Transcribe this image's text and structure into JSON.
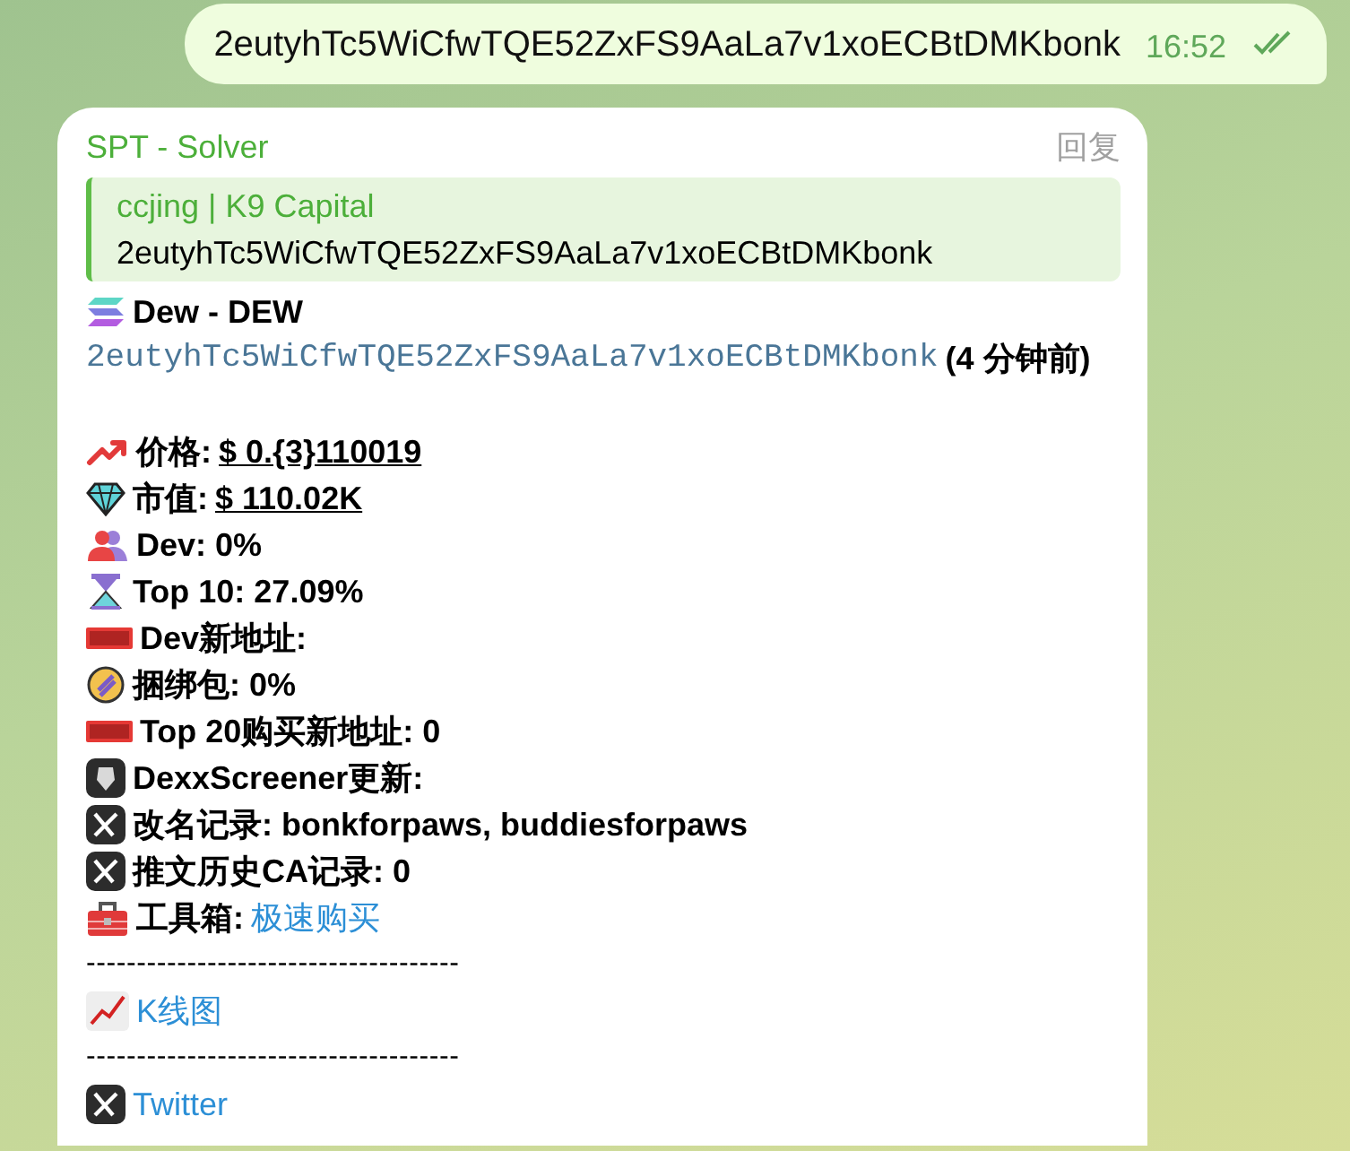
{
  "outgoing": {
    "text": "2eutyhTc5WiCfwTQE52ZxFS9AaLa7v1xoECBtDMKbonk",
    "time": "16:52",
    "read": true
  },
  "incoming": {
    "sender": "SPT - Solver",
    "reply_label": "回复",
    "quote": {
      "author": "ccjing | K9 Capital",
      "text": "2eutyhTc5WiCfwTQE52ZxFS9AaLa7v1xoECBtDMKbonk"
    },
    "token": "Dew - DEW",
    "address": "2eutyhTc5WiCfwTQE52ZxFS9AaLa7v1xoECBtDMKbonk",
    "age": "(4 分钟前)",
    "items": [
      {
        "kind": "metric",
        "label": "价格:",
        "value": "$ 0.{3}110019"
      },
      {
        "kind": "metric",
        "label": "市值:",
        "value": "$ 110.02K"
      },
      {
        "kind": "stat",
        "label": "Dev: 0%"
      },
      {
        "kind": "stat",
        "label": "Top 10: 27.09%"
      },
      {
        "kind": "stat",
        "label": "Dev新地址:"
      },
      {
        "kind": "stat",
        "label": "捆绑包: 0%"
      },
      {
        "kind": "stat",
        "label": "Top 20购买新地址: 0"
      },
      {
        "kind": "stat",
        "label": "DexxScreener更新:"
      },
      {
        "kind": "stat",
        "label": "改名记录: bonkforpaws, buddiesforpaws"
      },
      {
        "kind": "stat",
        "label": "推文历史CA记录: 0"
      },
      {
        "kind": "tool",
        "label": "工具箱:",
        "value": "极速购买"
      },
      {
        "kind": "divider",
        "text": "-------------------------------------"
      },
      {
        "kind": "link",
        "text": "K线图"
      },
      {
        "kind": "divider",
        "text": "-------------------------------------"
      },
      {
        "kind": "link",
        "text": "Twitter"
      }
    ]
  }
}
